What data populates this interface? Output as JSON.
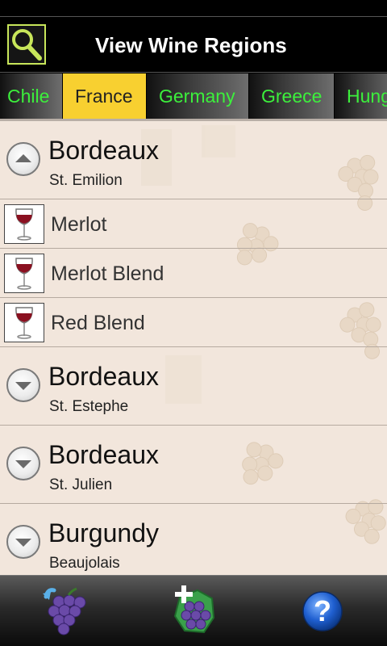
{
  "header": {
    "title": "View Wine Regions",
    "search_icon": "search-icon"
  },
  "tabs": [
    {
      "label": "Chile",
      "selected": false
    },
    {
      "label": "France",
      "selected": true
    },
    {
      "label": "Germany",
      "selected": false
    },
    {
      "label": "Greece",
      "selected": false
    },
    {
      "label": "Hung",
      "selected": false
    }
  ],
  "list": {
    "groups": [
      {
        "title": "Bordeaux",
        "subtitle": "St. Emilion",
        "expanded": true,
        "children": [
          "Merlot",
          "Merlot Blend",
          "Red Blend"
        ]
      },
      {
        "title": "Bordeaux",
        "subtitle": "St. Estephe",
        "expanded": false
      },
      {
        "title": "Bordeaux",
        "subtitle": "St. Julien",
        "expanded": false
      },
      {
        "title": "Burgundy",
        "subtitle": "Beaujolais",
        "expanded": false
      }
    ]
  },
  "bottom_bar": {
    "buttons": [
      "back-grapes-icon",
      "add-region-icon",
      "help-icon"
    ],
    "help_glyph": "?"
  },
  "colors": {
    "tab_text": "#3cf03c",
    "tab_selected_bg": "#f8d030",
    "list_bg": "#f2e6dc",
    "search_border": "#c8e65a",
    "help_blue": "#1f5fd0"
  }
}
